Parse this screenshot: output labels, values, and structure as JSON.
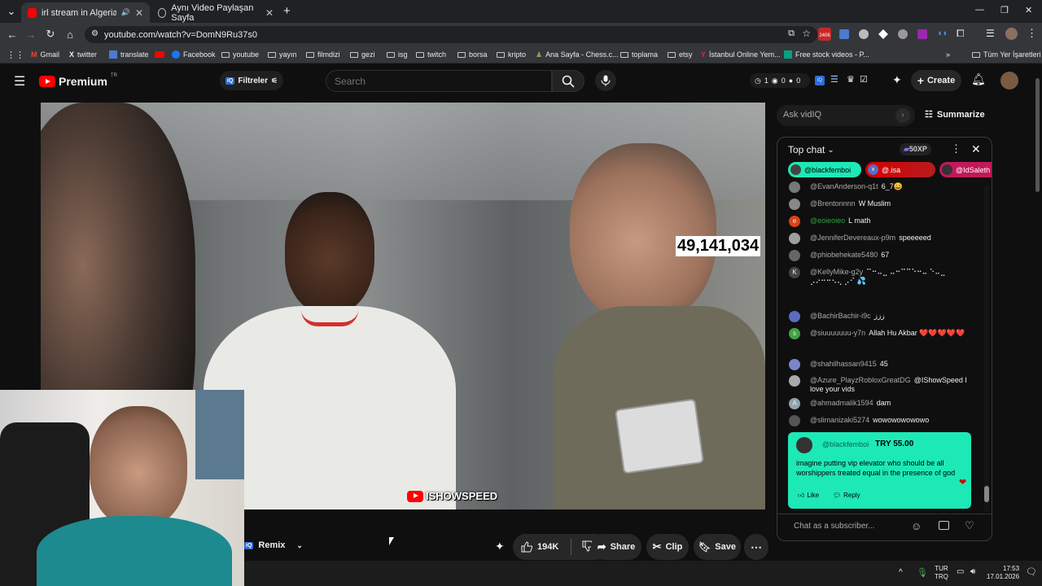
{
  "browser": {
    "tabs": [
      {
        "title": "irl stream in Algeria oz - Yo",
        "active": true
      },
      {
        "title": "Aynı Video Paylaşan Sayfa",
        "active": false
      }
    ],
    "new_tab": "+",
    "url": "youtube.com/watch?v=DomN9Ru37s0",
    "ext_badge": "2406",
    "bookmarks": [
      "Gmail",
      "twitter",
      "translate",
      "Facebook",
      "youtube",
      "yayın",
      "filmdizi",
      "gezi",
      "isg",
      "twitch",
      "borsa",
      "kripto",
      "Ana Sayfa - Chess.c...",
      "toplama",
      "etsy",
      "İstanbul Online Yem...",
      "Free stock videos - P..."
    ],
    "bookmarks_more": "»",
    "all_bookmarks": "Tüm Yer İşaretleri"
  },
  "youtube": {
    "brand": "Premium",
    "region": "TR",
    "filters_label": "Filtreler",
    "search_placeholder": "Search",
    "stats": {
      "a": "1",
      "b": "0",
      "c": "0"
    },
    "create_label": "Create",
    "overlay_count": "49,141,034",
    "watermark": "ISHOWSPEED",
    "remix_label": "Remix",
    "likes": "194K",
    "share_label": "Share",
    "clip_label": "Clip",
    "save_label": "Save"
  },
  "vidiq": {
    "ask_placeholder": "Ask vidIQ",
    "summarize_label": "Summarize"
  },
  "chat": {
    "mode": "Top chat",
    "xp": "50XP",
    "pinned": [
      "@blackfemboi",
      "@.isa",
      "@IdSaleth"
    ],
    "messages": [
      {
        "user": "@EvanAnderson-q1t",
        "text": "6_7😄",
        "avatar": "#777"
      },
      {
        "user": "@Brentonnnn",
        "text": "W Muslim",
        "avatar": "#888"
      },
      {
        "user": "@eoieoieo",
        "text": "L math",
        "avatar": "#d84315",
        "green": true
      },
      {
        "user": "@JenniferDevereaux-p9m",
        "text": "speeeeed",
        "avatar": "#9e9e9e"
      },
      {
        "user": "@phiobehekate5480",
        "text": "67",
        "avatar": "#666"
      },
      {
        "user": "@KellyMike-g2y",
        "text": "⠉⠒⠤⣀ ⠤⠒⠉⠉⠑⠒⠤ ⠑⠤⣀ ⡠⠔⠒⠒⠢⢄ ⡠⠊  💦",
        "avatar": "#444",
        "initial": "K"
      },
      {
        "user": "@BachirBachir-i9c",
        "text": "ززز",
        "avatar": "#5c6bc0"
      },
      {
        "user": "@siuuuuuuu-y7n",
        "text": "Allah Hu Akbar ❤️❤️❤️❤️❤️",
        "avatar": "#43a047",
        "initial": "s"
      },
      {
        "user": "@shahilhassan9415",
        "text": "45",
        "avatar": "#7986cb"
      },
      {
        "user": "@Azure_PlayzRobloxGreatDG",
        "text": "@IShowSpeed I love your vids",
        "avatar": "#aaa"
      },
      {
        "user": "@ahmadmalik1594",
        "text": "dam",
        "avatar": "#90a4ae",
        "initial": "A"
      },
      {
        "user": "@slimanizaki5274",
        "text": "wowowowowowo",
        "avatar": "#555"
      }
    ],
    "superchat": {
      "user": "@blackfemboi",
      "amount": "TRY 55.00",
      "text": "imagine putting vip elevator who should be all worshippers treated equal in the presence of god",
      "like": "Like",
      "reply": "Reply"
    },
    "input_placeholder": "Chat as a subscriber..."
  },
  "taskbar": {
    "lang": "TUR",
    "lang2": "TRQ",
    "time": "17:53",
    "date": "17.01.2026"
  },
  "colors": {
    "accent_red": "#ff0000",
    "superchat": "#1de9b6",
    "vidiq_blue": "#2b6cd9"
  }
}
